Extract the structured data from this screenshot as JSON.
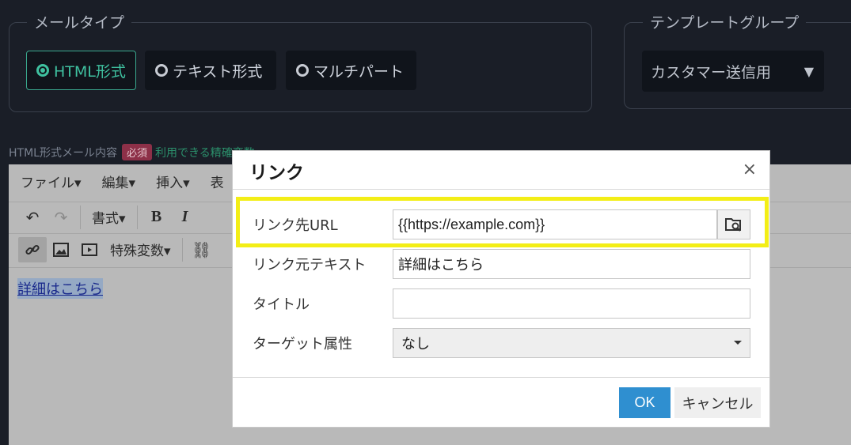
{
  "mail_type": {
    "legend": "メールタイプ",
    "options": [
      {
        "label": "HTML形式",
        "selected": true
      },
      {
        "label": "テキスト形式",
        "selected": false
      },
      {
        "label": "マルチパート",
        "selected": false
      }
    ]
  },
  "template_group": {
    "legend": "テンプレートグループ",
    "value": "カスタマー送信用"
  },
  "content": {
    "label": "HTML形式メール内容",
    "required_badge": "必須",
    "variables_link": "利用できる精確変数"
  },
  "editor": {
    "menu": [
      "ファイル▾",
      "編集▾",
      "挿入▾",
      "表"
    ],
    "format_label": "書式▾",
    "special_vars_label": "特殊変数▾",
    "body_link_text": "詳細はこちら"
  },
  "dialog": {
    "title": "リンク",
    "close_glyph": "×",
    "fields": {
      "url_label": "リンク先URL",
      "url_value": "{{https://example.com}}",
      "text_label": "リンク元テキスト",
      "text_value": "詳細はこちら",
      "title_label": "タイトル",
      "title_value": "",
      "target_label": "ターゲット属性",
      "target_value": "なし"
    },
    "ok_label": "OK",
    "cancel_label": "キャンセル"
  },
  "colors": {
    "accent_green": "#3fc1a0",
    "ok_blue": "#2f8fd0",
    "highlight_yellow": "#f3ee16",
    "badge_red": "#8d3048"
  }
}
